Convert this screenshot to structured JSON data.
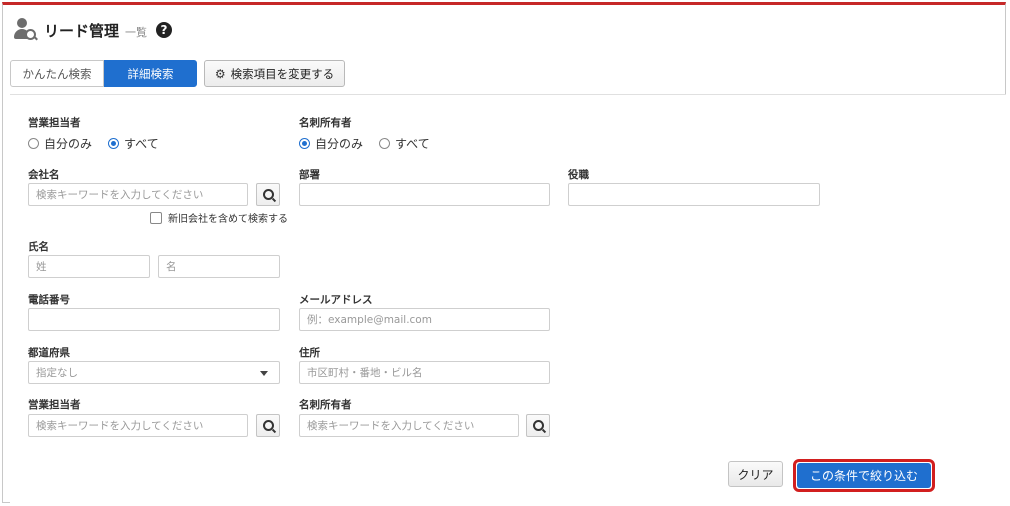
{
  "header": {
    "title": "リード管理",
    "subtitle": "一覧",
    "help_icon": "question-circle-icon"
  },
  "tabs": [
    {
      "label": "かんたん検索",
      "active": false
    },
    {
      "label": "詳細検索",
      "active": true
    }
  ],
  "change_fields_button": {
    "icon": "gear-icon",
    "label": "検索項目を変更する"
  },
  "form": {
    "sales_rep_scope": {
      "label": "営業担当者",
      "options": [
        "自分のみ",
        "すべて"
      ],
      "selected": "すべて"
    },
    "card_owner_scope": {
      "label": "名刺所有者",
      "options": [
        "自分のみ",
        "すべて"
      ],
      "selected": "自分のみ"
    },
    "company": {
      "label": "会社名",
      "placeholder": "検索キーワードを入力してください",
      "checkbox_label": "新旧会社を含めて検索する",
      "checked": false
    },
    "department": {
      "label": "部署",
      "value": ""
    },
    "position": {
      "label": "役職",
      "value": ""
    },
    "name": {
      "label": "氏名",
      "last_placeholder": "姓",
      "first_placeholder": "名"
    },
    "phone": {
      "label": "電話番号",
      "value": ""
    },
    "email": {
      "label": "メールアドレス",
      "placeholder": "例：example@mail.com"
    },
    "prefecture": {
      "label": "都道府県",
      "selected": "指定なし"
    },
    "address": {
      "label": "住所",
      "placeholder": "市区町村・番地・ビル名"
    },
    "sales_rep": {
      "label": "営業担当者",
      "placeholder": "検索キーワードを入力してください"
    },
    "card_owner": {
      "label": "名刺所有者",
      "placeholder": "検索キーワードを入力してください"
    }
  },
  "actions": {
    "clear_label": "クリア",
    "apply_label": "この条件で絞り込む"
  },
  "colors": {
    "accent": "#1f6fcf",
    "header_bar": "#c62828",
    "highlight": "#d21f1f"
  }
}
